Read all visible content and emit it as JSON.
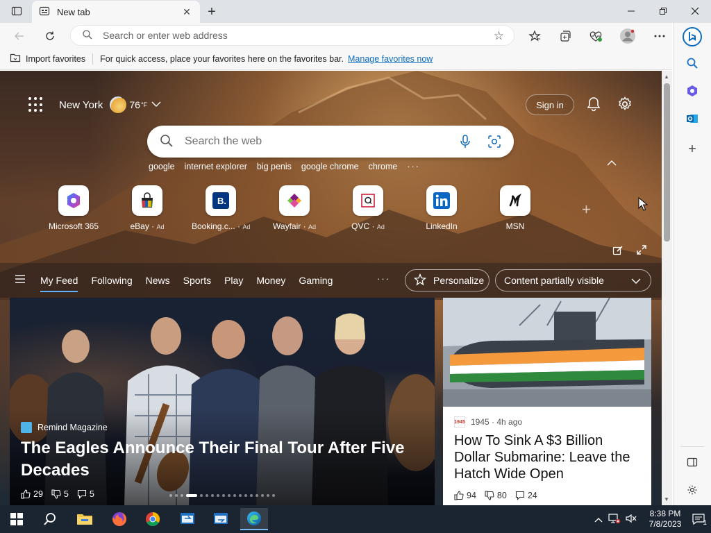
{
  "browser": {
    "tab_title": "New tab",
    "omnibox_placeholder": "Search or enter web address"
  },
  "favorites_bar": {
    "import_label": "Import favorites",
    "hint": "For quick access, place your favorites here on the favorites bar.",
    "manage_link": "Manage favorites now"
  },
  "newtab": {
    "weather": {
      "city": "New York",
      "temp": "76",
      "unit": "°F"
    },
    "signin_label": "Sign in",
    "search_placeholder": "Search the web",
    "suggestions": [
      "google",
      "internet explorer",
      "big penis",
      "google chrome",
      "chrome"
    ],
    "tiles": [
      {
        "label": "Microsoft 365",
        "ad": "",
        "icon": "microsoft-365-icon"
      },
      {
        "label": "eBay",
        "ad": "Ad",
        "icon": "ebay-icon"
      },
      {
        "label": "Booking.c...",
        "ad": "Ad",
        "icon": "booking-icon"
      },
      {
        "label": "Wayfair",
        "ad": "Ad",
        "icon": "wayfair-icon"
      },
      {
        "label": "QVC",
        "ad": "Ad",
        "icon": "qvc-icon"
      },
      {
        "label": "LinkedIn",
        "ad": "",
        "icon": "linkedin-icon"
      },
      {
        "label": "MSN",
        "ad": "",
        "icon": "msn-icon"
      }
    ],
    "feed_tabs": [
      "My Feed",
      "Following",
      "News",
      "Sports",
      "Play",
      "Money",
      "Gaming"
    ],
    "personalize_label": "Personalize",
    "visibility_label": "Content partially visible"
  },
  "hero": {
    "source": "Remind Magazine",
    "headline": "The Eagles Announce Their Final Tour After Five Decades",
    "likes": "29",
    "dislikes": "5",
    "comments": "5"
  },
  "card2": {
    "source": "1945",
    "source_logo": "1945",
    "age": "4h ago",
    "title": "How To Sink A $3 Billion Dollar Submarine: Leave the Hatch Wide Open",
    "likes": "94",
    "dislikes": "80",
    "comments": "24"
  },
  "taskbar": {
    "time": "8:38 PM",
    "date": "7/8/2023",
    "notifications": "1"
  },
  "colors": {
    "accent": "#0f6cbd",
    "taskbar": "#1b2431"
  }
}
